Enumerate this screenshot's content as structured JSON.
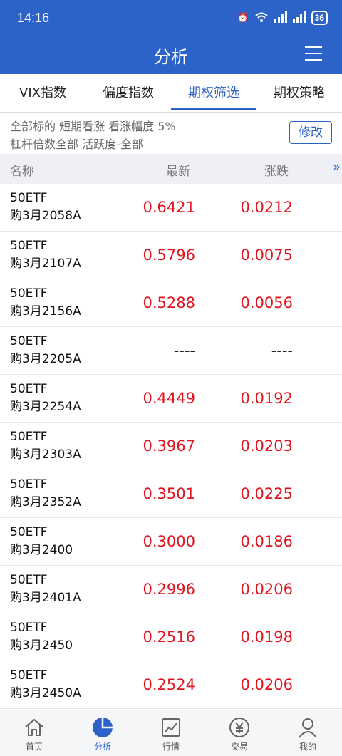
{
  "status_bar": {
    "time": "14:16",
    "battery": "36"
  },
  "header": {
    "title": "分析"
  },
  "tabs": [
    {
      "label": "VIX指数",
      "active": false
    },
    {
      "label": "偏度指数",
      "active": false
    },
    {
      "label": "期权筛选",
      "active": true
    },
    {
      "label": "期权策略",
      "active": false
    }
  ],
  "filter": {
    "line1": "全部标的 短期看涨 看涨幅度 5%",
    "line2": "杠杆倍数全部 活跃度-全部",
    "edit_label": "修改"
  },
  "table": {
    "headers": {
      "name": "名称",
      "latest": "最新",
      "change": "涨跌",
      "more": "»"
    },
    "rows": [
      {
        "name1": "50ETF",
        "name2": "购3月2058A",
        "latest": "0.6421",
        "change": "0.0212"
      },
      {
        "name1": "50ETF",
        "name2": "购3月2107A",
        "latest": "0.5796",
        "change": "0.0075"
      },
      {
        "name1": "50ETF",
        "name2": "购3月2156A",
        "latest": "0.5288",
        "change": "0.0056"
      },
      {
        "name1": "50ETF",
        "name2": "购3月2205A",
        "latest": "----",
        "change": "----"
      },
      {
        "name1": "50ETF",
        "name2": "购3月2254A",
        "latest": "0.4449",
        "change": "0.0192"
      },
      {
        "name1": "50ETF",
        "name2": "购3月2303A",
        "latest": "0.3967",
        "change": "0.0203"
      },
      {
        "name1": "50ETF",
        "name2": "购3月2352A",
        "latest": "0.3501",
        "change": "0.0225"
      },
      {
        "name1": "50ETF",
        "name2": "购3月2400",
        "latest": "0.3000",
        "change": "0.0186"
      },
      {
        "name1": "50ETF",
        "name2": "购3月2401A",
        "latest": "0.2996",
        "change": "0.0206"
      },
      {
        "name1": "50ETF",
        "name2": "购3月2450",
        "latest": "0.2516",
        "change": "0.0198"
      },
      {
        "name1": "50ETF",
        "name2": "购3月2450A",
        "latest": "0.2524",
        "change": "0.0206"
      }
    ]
  },
  "bottom_nav": [
    {
      "label": "首页",
      "icon": "home-icon",
      "active": false
    },
    {
      "label": "分析",
      "icon": "pie-chart-icon",
      "active": true
    },
    {
      "label": "行情",
      "icon": "line-chart-icon",
      "active": false
    },
    {
      "label": "交易",
      "icon": "yen-icon",
      "active": false
    },
    {
      "label": "我的",
      "icon": "user-icon",
      "active": false
    }
  ],
  "colors": {
    "primary": "#2c63c8",
    "up": "#e0141e"
  }
}
